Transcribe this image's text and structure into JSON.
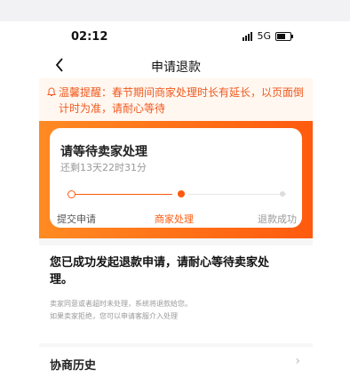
{
  "status_bar": {
    "time": "02:12",
    "network": "5G"
  },
  "nav": {
    "title": "申请退款"
  },
  "notice": {
    "text": "温馨提醒：春节期间商家处理时长有延长，以页面倒计时为准，请耐心等待"
  },
  "progress_card": {
    "title": "请等待卖家处理",
    "countdown": "还剩13天22时31分",
    "steps": [
      "提交申请",
      "商家处理",
      "退款成功"
    ],
    "current_step": 2
  },
  "message": {
    "headline": "您已成功发起退款申请，请耐心等待卖家处理。",
    "line1": "卖家同意或者超时未处理，系统将退款给您。",
    "line2": "如果卖家拒绝，您可以申请客服介入处理"
  },
  "history": {
    "label": "协商历史"
  },
  "colors": {
    "accent": "#ff5a0e",
    "accent_light": "#ff8a22",
    "notice_text": "#f05a20"
  }
}
